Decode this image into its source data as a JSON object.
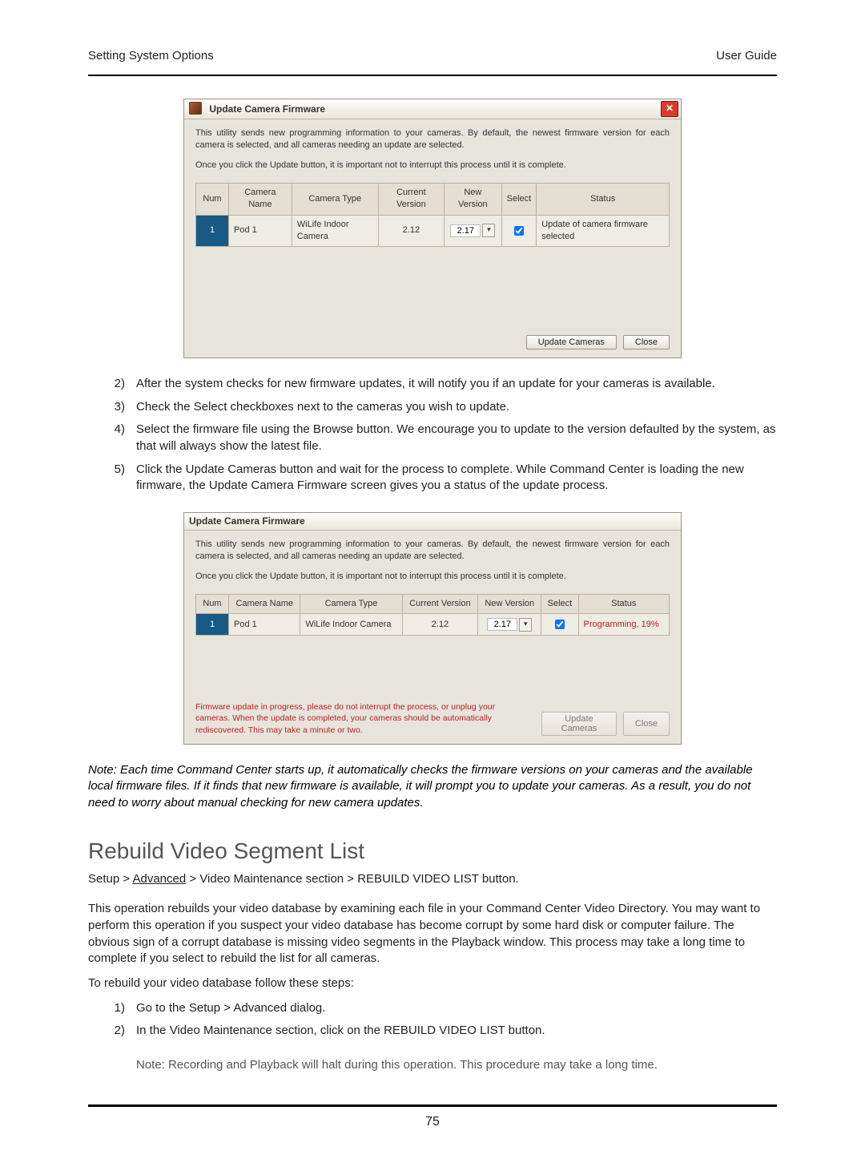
{
  "header": {
    "left": "Setting System Options",
    "right": "User Guide"
  },
  "dialog1": {
    "title": "Update Camera Firmware",
    "desc": "This utility sends new programming information to your cameras.  By default, the newest firmware version for each camera is selected, and all cameras needing an update are selected.",
    "desc2": "Once you click the Update button, it is important not to interrupt this process until it is complete.",
    "columns": [
      "Num",
      "Camera Name",
      "Camera Type",
      "Current Version",
      "New Version",
      "Select",
      "Status"
    ],
    "row": {
      "num": "1",
      "name": "Pod 1",
      "type": "WiLife Indoor Camera",
      "cur": "2.12",
      "new": "2.17",
      "checked": true,
      "status": "Update of camera firmware selected"
    },
    "btn_update": "Update Cameras",
    "btn_close": "Close"
  },
  "steps1": [
    {
      "n": "2)",
      "t": "After the system checks for new firmware updates, it will notify you if an update for your cameras is available."
    },
    {
      "n": "3)",
      "t": "Check the  Select  checkboxes next to the cameras you wish to update."
    },
    {
      "n": "4)",
      "t": "Select the firmware file using the Browse button.  We encourage you to update to the version defaulted by the system, as that will always show the latest file."
    },
    {
      "n": "5)",
      "t": "Click the Update Cameras button and wait for the process to complete.  While Command Center is loading the new firmware, the Update Camera Firmware screen gives you a status of the update process."
    }
  ],
  "dialog2": {
    "title": "Update Camera Firmware",
    "desc": "This utility sends new programming information to your cameras.  By default, the newest firmware version for each camera is selected, and all cameras needing an update are selected.",
    "desc2": "Once you click the Update button, it is important not to interrupt this process until it is complete.",
    "columns": [
      "Num",
      "Camera Name",
      "Camera Type",
      "Current Version",
      "New Version",
      "Select",
      "Status"
    ],
    "row": {
      "num": "1",
      "name": "Pod 1",
      "type": "WiLife Indoor Camera",
      "cur": "2.12",
      "new": "2.17",
      "checked": true,
      "status": "Programming, 19%"
    },
    "warn": "Firmware update in progress, please do not interrupt the process, or unplug your cameras. When the update is completed, your cameras should be automatically rediscovered.  This may take a minute or two.",
    "btn_update": "Update Cameras",
    "btn_close": "Close"
  },
  "note_italic": "Note: Each time Command Center starts up, it automatically checks the firmware versions on your cameras and the available local firmware files. If it finds that new firmware is available, it will prompt you to update your cameras. As a result, you do not need to worry about manual checking for new camera updates.",
  "section2": {
    "title": "Rebuild Video Segment List",
    "path_parts": [
      "Setup > ",
      "Advanced",
      " > Video Maintenance section > REBUILD VIDEO LIST button."
    ],
    "para": "This operation rebuilds your video database by examining each file in your Command Center Video Directory. You may want to perform this operation if you suspect your video database has become corrupt by some hard disk or computer failure. The obvious sign of a corrupt database is missing video segments in the Playback window. This process may take a long time to complete if you select to rebuild the list for all cameras.",
    "lead": "To rebuild your video database follow these steps:",
    "steps": [
      {
        "n": "1)",
        "t": "Go to the Setup > Advanced dialog."
      },
      {
        "n": "2)",
        "t": "In the Video Maintenance section, click on the REBUILD VIDEO LIST button."
      }
    ],
    "subnote": "Note: Recording and Playback will halt during this operation.  This procedure may take a long time."
  },
  "page_number": "75"
}
